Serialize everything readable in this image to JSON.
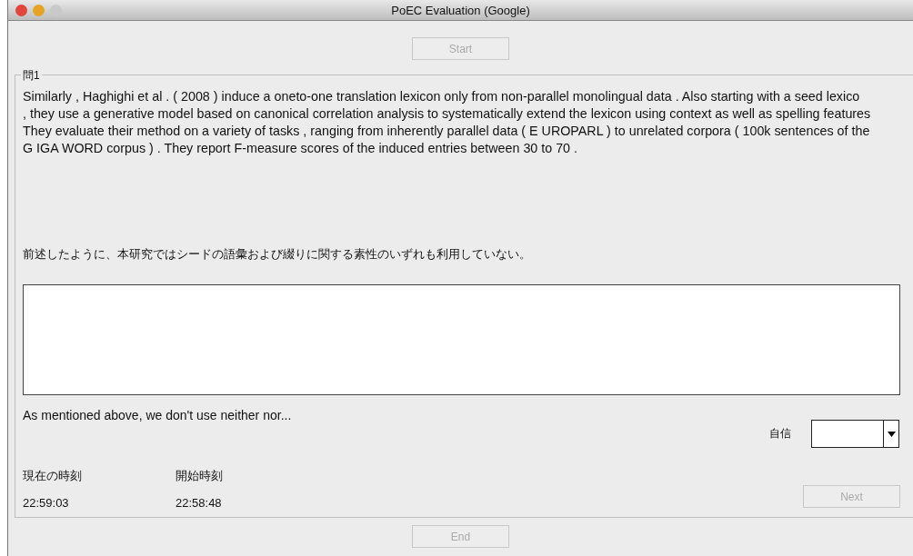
{
  "window": {
    "title": "PoEC Evaluation (Google)"
  },
  "start_button": {
    "label": "Start",
    "disabled": true
  },
  "question": {
    "legend": "問1",
    "source_lines": [
      "Similarly , Haghighi et al . ( 2008 ) induce a oneto-one translation lexicon only from non-parallel monolingual data . Also starting with a seed lexico",
      ", they use a generative model based on canonical correlation analysis to systematically extend the lexicon using context as well as spelling features",
      "They evaluate their method on a variety of tasks , ranging from inherently parallel data ( E UROPARL ) to unrelated corpora ( 100k sentences of the",
      "G IGA WORD corpus ) . They report F-measure scores of the induced entries between 30 to 70 ."
    ],
    "translation": "前述したように、本研究ではシードの語彙および綴りに関する素性のいずれも利用していない。",
    "machine_output": "As mentioned above, we don't use neither nor...",
    "confidence_label": "自信",
    "current_time_label": "現在の時刻",
    "current_time": "22:59:03",
    "start_time_label": "開始時刻",
    "start_time": "22:58:48",
    "next_button": {
      "label": "Next",
      "disabled": true
    }
  },
  "end_button": {
    "label": "End",
    "disabled": true
  }
}
